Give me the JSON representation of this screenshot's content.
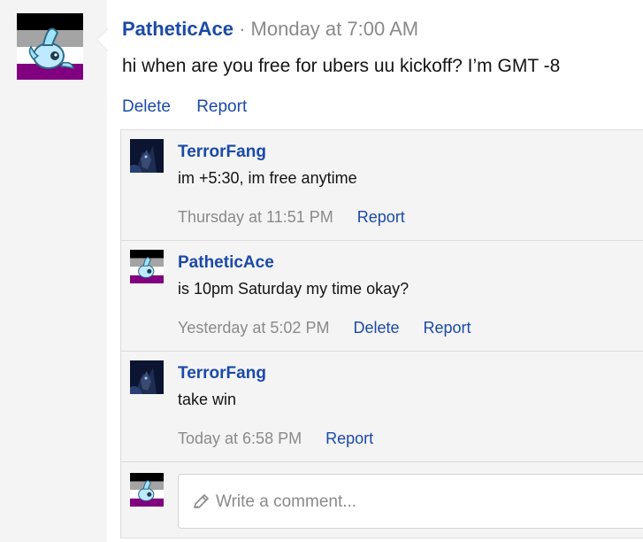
{
  "post": {
    "author": "PatheticAce",
    "separator": "·",
    "timestamp": "Monday at 7:00 AM",
    "body": "hi when are you free for ubers uu kickoff? I’m GMT -8",
    "actions": [
      "Delete",
      "Report"
    ]
  },
  "comments": [
    {
      "author": "TerrorFang",
      "text": "im +5:30, im free anytime",
      "time": "Thursday at 11:51 PM",
      "actions": [
        "Report"
      ]
    },
    {
      "author": "PatheticAce",
      "text": "is 10pm Saturday my time okay?",
      "time": "Yesterday at 5:02 PM",
      "actions": [
        "Delete",
        "Report"
      ]
    },
    {
      "author": "TerrorFang",
      "text": "take win",
      "time": "Today at 6:58 PM",
      "actions": [
        "Report"
      ]
    }
  ],
  "reply": {
    "placeholder": "Write a comment..."
  },
  "colors": {
    "link": "#1b4aa8",
    "muted": "#8a8a8a",
    "panel": "#f4f4f4",
    "flag_purple": "#800080",
    "flag_grey": "#a4a4a4"
  },
  "icons": {
    "avatar_ace": "asexual-flag-fish-avatar",
    "avatar_terror": "dark-character-avatar",
    "pencil": "pencil-icon"
  }
}
